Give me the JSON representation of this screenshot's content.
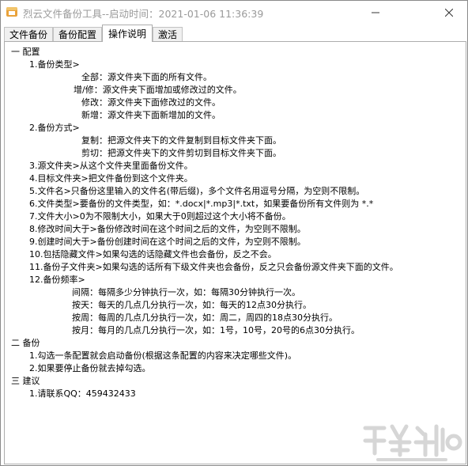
{
  "window": {
    "title": "烈云文件备份工具--启动时间：2021-01-06 11:36:39"
  },
  "tabs": [
    "文件备份",
    "备份配置",
    "操作说明",
    "激活"
  ],
  "active_tab": 2,
  "doc": {
    "sec1": "一 配置",
    "i1": "1.备份类型>",
    "i1a": "全部：源文件夹下面的所有文件。",
    "i1b": "增/修：源文件夹下面增加或修改过的文件。",
    "i1c": "修改：源文件夹下面修改过的文件。",
    "i1d": "新增：源文件夹下面新增加的文件。",
    "i2": "2.备份方式>",
    "i2a": "复制：把源文件夹下的文件复制到目标文件夹下面。",
    "i2b": "剪切：把源文件夹下的文件剪切到目标文件夹下面。",
    "i3": "3.源文件夹>从这个文件夹里面备份文件。",
    "i4": "4.目标文件夹>把文件备份到这个文件夹。",
    "i5": "5.文件名>只备份这里输入的文件名(带后缀)，多个文件名用逗号分隔，为空则不限制。",
    "i6": "6.文件类型>要备份的文件类型，如：*.docx|*.mp3|*.txt，如果要备份所有文件则为 *.*",
    "i7": "7.文件大小>0为不限制大小，如果大于0则超过这个大小将不备份。",
    "i8": "8.修改时间大于>备份修改时间在这个时间之后的文件，为空则不限制。",
    "i9": "9.创建时间大于>备份创建时间在这个时间之后的文件，为空则不限制。",
    "i10": "10.包括隐藏文件>如果勾选的话隐藏文件也会备份，反之不会。",
    "i11": "11.备份子文件夹>如果勾选的话所有下级文件夹也会备份，反之只会备份源文件夹下面的文件。",
    "i12": "12.备份频率>",
    "i12a": "间隔：每隔多少分钟执行一次，如：每隔30分钟执行一次。",
    "i12b": "按天：每天的几点几分执行一次，如：每天的12点30分执行。",
    "i12c": "按周：每周的几点几分执行一次，如：周二，周四的18点30分执行。",
    "i12d": "按月：每月的几点几分执行一次，如：1号，10号，20号的6点30分执行。",
    "sec2": "二 备份",
    "b1": "1.勾选一条配置就会启动备份(根据这条配置的内容来决定哪些文件)。",
    "b2": "2.如果要停止备份就去掉勾选。",
    "sec3": "三 建议",
    "c1": "1.请联系QQ：459432433"
  },
  "icons": {
    "app": "app-icon",
    "minimize": "minimize-icon",
    "close": "close-icon"
  }
}
